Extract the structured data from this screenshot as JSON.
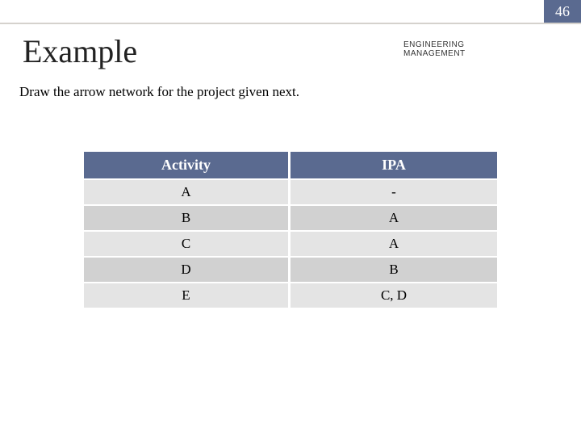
{
  "page_number": "46",
  "title": "Example",
  "department_line1": "ENGINEERING",
  "department_line2": "MANAGEMENT",
  "subtitle": "Draw the arrow network for the project given next.",
  "table": {
    "headers": {
      "col1": "Activity",
      "col2": "IPA"
    },
    "rows": [
      {
        "activity": "A",
        "ipa": "-"
      },
      {
        "activity": "B",
        "ipa": "A"
      },
      {
        "activity": "C",
        "ipa": "A"
      },
      {
        "activity": "D",
        "ipa": "B"
      },
      {
        "activity": "E",
        "ipa": "C, D"
      }
    ]
  }
}
